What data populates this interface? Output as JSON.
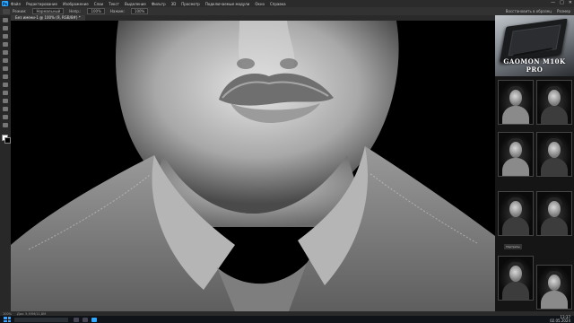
{
  "app": {
    "logo": "Ps",
    "menu": [
      "Файл",
      "Редактирование",
      "Изображение",
      "Слои",
      "Текст",
      "Выделение",
      "Фильтр",
      "3D",
      "Просмотр",
      "Подключаемые модули",
      "Окно",
      "Справка"
    ],
    "window_controls": [
      "—",
      "□",
      "✕"
    ]
  },
  "options": {
    "items": [
      "Режим:",
      "Нормальный",
      "Непр.:",
      "100%",
      "Нажим:",
      "100%"
    ],
    "right_items": [
      "Восстановить в образец",
      "Размер"
    ]
  },
  "document": {
    "tab_label": "Без имени-1 @ 100% (Я, RGB/8#) *"
  },
  "status": {
    "zoom": "100%",
    "info": "Док: 5,93M/11,8M"
  },
  "taskbar": {
    "time": "13:37",
    "date": "02.05.2024"
  },
  "sidebar": {
    "ad_caption": "GAOMON M10K PRO",
    "mini_label": "Портреты"
  },
  "colors": {
    "accent": "#31a8ff",
    "canvas_bg": "#000000",
    "ui_dark": "#282828"
  },
  "icons": [
    "move-icon",
    "marquee-icon",
    "lasso-icon",
    "crop-icon",
    "eyedropper-icon",
    "brush-icon",
    "stamp-icon",
    "eraser-icon",
    "gradient-icon",
    "dodge-icon",
    "pen-icon",
    "type-icon",
    "hand-icon",
    "zoom-icon"
  ]
}
